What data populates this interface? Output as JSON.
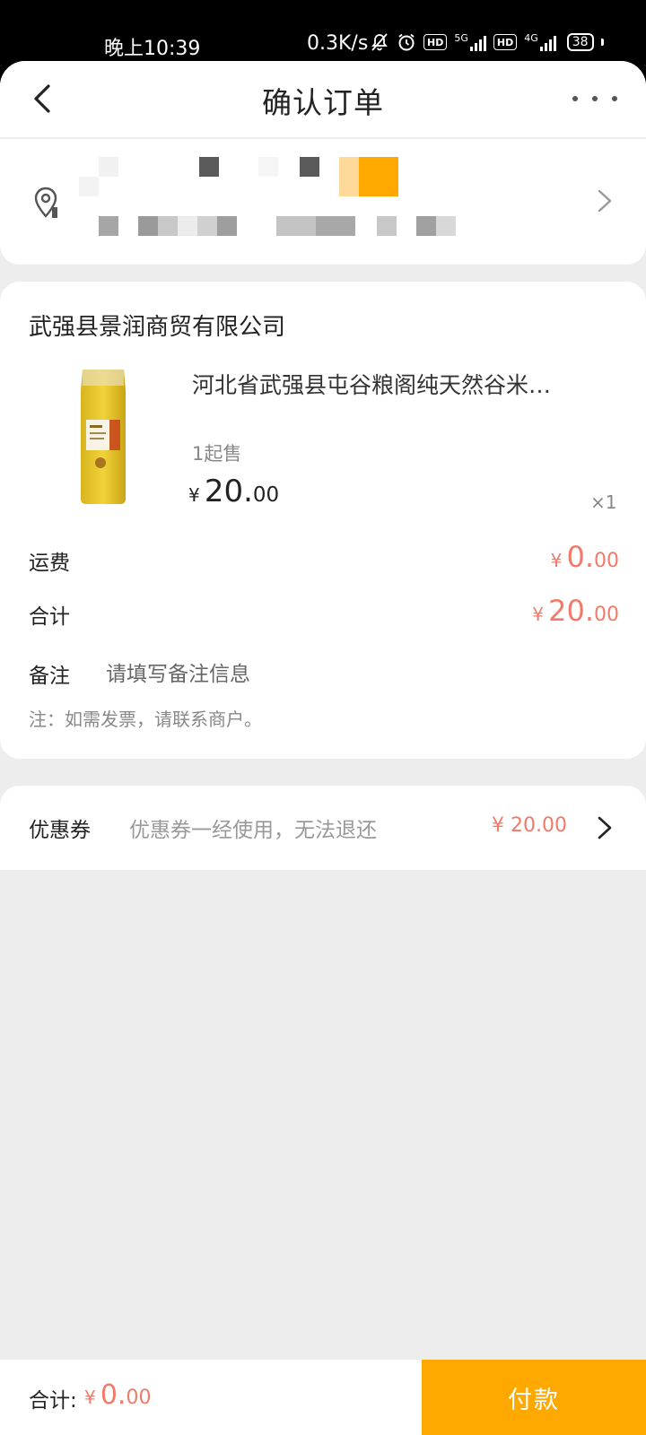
{
  "status_bar": {
    "time": "晚上10:39",
    "speed": "0.3K/s",
    "hd_label": "HD",
    "net_5g": "5G",
    "net_4g": "4G",
    "battery": "38"
  },
  "nav": {
    "title": "确认订单"
  },
  "order": {
    "store_name": "武强县景润商贸有限公司",
    "product": {
      "title": "河北省武强县屯谷粮阁纯天然谷米…",
      "min_sale": "1起售",
      "price_symbol": "¥",
      "price_int": "20.",
      "price_dec": "00",
      "quantity": "×1"
    },
    "shipping": {
      "label": "运费",
      "symbol": "¥",
      "int": "0.",
      "dec": "00"
    },
    "subtotal": {
      "label": "合计",
      "symbol": "¥",
      "int": "20.",
      "dec": "00"
    },
    "remark": {
      "label": "备注",
      "placeholder": "请填写备注信息"
    },
    "note": "注：如需发票，请联系商户。"
  },
  "coupon": {
    "label": "优惠券",
    "hint": "优惠券一经使用，无法退还",
    "value": "¥ 20.00"
  },
  "bottom_bar": {
    "total_label": "合计:",
    "symbol": "¥",
    "int": "0.",
    "dec": "00",
    "pay_label": "付款"
  },
  "colors": {
    "accent": "#ffa800",
    "price_red": "#f07b6b",
    "background": "#ededed"
  }
}
